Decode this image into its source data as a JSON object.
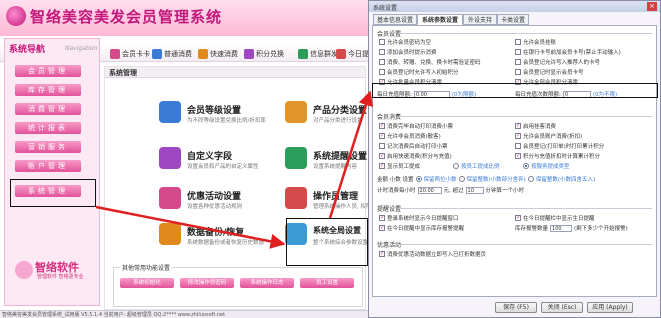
{
  "app": {
    "title": "智络美容美发会员管理系统",
    "toolbar": [
      {
        "label": "会员卡卡",
        "icon": "card-icon",
        "color": "#d44a8a"
      },
      {
        "label": "普通消费",
        "icon": "cart-icon",
        "color": "#3a7bd5"
      },
      {
        "label": "快速消费",
        "icon": "lightning-icon",
        "color": "#e08a1e"
      },
      {
        "label": "积分兑换",
        "icon": "gift-icon",
        "color": "#9d48c2"
      },
      {
        "label": "信息群发",
        "icon": "message-icon",
        "color": "#2a9d5a"
      },
      {
        "label": "今日提醒",
        "icon": "bell-icon",
        "color": "#d44a4a"
      }
    ]
  },
  "nav": {
    "title": "系统导航",
    "subtitle": "Navigation",
    "items": [
      {
        "label": "会员管理"
      },
      {
        "label": "库存管理"
      },
      {
        "label": "消费管理"
      },
      {
        "label": "统计报表"
      },
      {
        "label": "营销服务"
      },
      {
        "label": "账户管理"
      },
      {
        "label": "系统管理"
      }
    ],
    "brand": "智络软件",
    "brand_sub": "管理软件 智络更专业"
  },
  "content": {
    "title": "系统管理",
    "tiles": [
      {
        "title": "会员等级设置",
        "desc": "为不同等级设置兑换比例/折扣率",
        "icon": "member-level-icon",
        "color": "#3a7bd5"
      },
      {
        "title": "产品分类设置",
        "desc": "对产品分类进行设置",
        "icon": "category-icon",
        "color": "#e0952a"
      },
      {
        "title": "自定义字段",
        "desc": "设置会员和产品的自定义属性",
        "icon": "custom-field-icon",
        "color": "#9d48c2"
      },
      {
        "title": "系统提醒设置",
        "desc": "设置系统提醒内容",
        "icon": "reminder-icon",
        "color": "#2a9d5a"
      },
      {
        "title": "优惠活动设置",
        "desc": "设置各种优惠活动规则",
        "icon": "promotion-icon",
        "color": "#d44a8a"
      },
      {
        "title": "操作员管理",
        "desc": "管理系统操作人员, 权限",
        "icon": "operator-icon",
        "color": "#d44a4a"
      },
      {
        "title": "数据备份/恢复",
        "desc": "系统数据备份或者恢复历史数据",
        "icon": "database-icon",
        "color": "#e08a1e"
      },
      {
        "title": "系统全局设置",
        "desc": "整个系统综合参数设置",
        "icon": "global-settings-icon",
        "color": "#3a9bd5"
      }
    ],
    "other_label": "其他常用功能设置",
    "other_buttons": [
      "系统初始化",
      "修改操作员密码",
      "系统操作日志",
      "员工设置"
    ]
  },
  "status": "智络美容美发会员管理系统_试用版 V5.5.1.4  当前用户: 超级管理员  QQ:2****  www.zhiluosoft.net",
  "dialog": {
    "title": "系统设置",
    "close": "×",
    "tabs": [
      "基本信息设置",
      "系统参数设置",
      "外设支持",
      "卡类设置"
    ],
    "active_tab": 1,
    "sections": {
      "member": "会员设置",
      "consume": "会员消费",
      "remind": "提醒设置",
      "promo": "优惠活动"
    },
    "member_opts": [
      {
        "label": "允许会员密码为空",
        "checked": false
      },
      {
        "label": "允许会员挂账",
        "checked": false
      },
      {
        "label": "添加会员时提示消费",
        "checked": false
      },
      {
        "label": "在银行卡号前加会员卡号(禁止手动输入)",
        "checked": false
      },
      {
        "label": "消费、转赠、兑换、换卡时需验证密码",
        "checked": false
      },
      {
        "label": "会员登记允许写入推荐人的卡号",
        "checked": false
      },
      {
        "label": "会员登记时允许写入初始积分",
        "checked": false
      },
      {
        "label": "会员登记时显示会员卡号",
        "checked": false
      },
      {
        "label": "允许批量会员积分清零",
        "checked": true
      },
      {
        "label": "允许全部会员积分清零",
        "checked": true
      }
    ],
    "daily_max_new": {
      "label": "每日充值限额:",
      "value": "0.00",
      "hint": "(0为限额)"
    },
    "daily_max_times": {
      "label": "每日充值次数限额:",
      "value": "0",
      "hint": "(0为不限)"
    },
    "consume_opts": [
      {
        "label": "消费完毕自动打印消费小票",
        "checked": true
      },
      {
        "label": "启用挂客消费",
        "checked": true
      },
      {
        "label": "允许非会员消费(散客)",
        "checked": true
      },
      {
        "label": "允许会员账户消费(折扣)",
        "checked": true
      },
      {
        "label": "记次消费后自动打印小票",
        "checked": false
      },
      {
        "label": "会员登记(打印单)时打印累计积分",
        "checked": false
      },
      {
        "label": "启用快速消费(积分与充值)",
        "checked": true
      },
      {
        "label": "积分与充值折扣时计算累计积分",
        "checked": true
      },
      {
        "label": "显示员工提成",
        "checked": true
      }
    ],
    "staff_mode": {
      "opt1": "按员工提成比例",
      "opt2": "按服务提成类型",
      "selected": 1
    },
    "rounding": {
      "label": "金额 小数 设置",
      "opt1": "保留两位小数",
      "opt2": "保留整数(小数部分舍弃)",
      "opt3": "保留整数(小数四舍五入)",
      "selected": 0
    },
    "points_rule": {
      "prefix": "计时消费每小时",
      "value": "20.00",
      "mid": "元, 超过",
      "value2": "10",
      "suffix": "分钟算一个小时"
    },
    "remind_opts": [
      {
        "label": "登录系统时显示今日提醒窗口",
        "checked": true
      },
      {
        "label": "在今日提醒栏中显示生日提醒",
        "checked": true
      },
      {
        "label": "在今日提醒中显示库存报警提醒",
        "checked": true
      }
    ],
    "stock_alarm": {
      "label": "库存报警数量",
      "value": "100",
      "hint": "(剩下多少个开始报警)"
    },
    "promo_opts": [
      {
        "label": "消费优惠活动数据立即写入已打折数据页",
        "checked": true
      }
    ],
    "buttons": {
      "save": "保存 (F5)",
      "close": "关闭 (Esc)",
      "apply": "应用 (Apply)"
    }
  }
}
